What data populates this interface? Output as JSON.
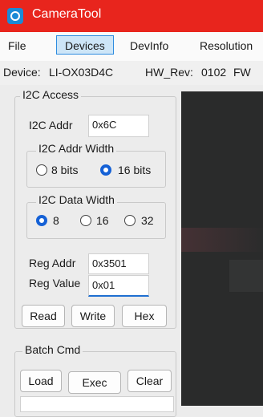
{
  "window": {
    "title": "CameraTool",
    "accent": "#e8251d"
  },
  "menu": {
    "items": [
      "File",
      "Devices",
      "DevInfo",
      "Resolution"
    ],
    "active": "Devices"
  },
  "device_info": {
    "device_label": "Device:",
    "device_value": "LI-OX03D4C",
    "hw_rev_label": "HW_Rev:",
    "hw_rev_value": "0102",
    "next": "FW"
  },
  "i2c_access": {
    "title": "I2C Access",
    "addr_label": "I2C Addr",
    "addr_value": "0x6C",
    "addr_width": {
      "title": "I2C Addr Width",
      "options": [
        "8 bits",
        "16 bits"
      ],
      "selected": "16 bits"
    },
    "data_width": {
      "title": "I2C Data Width",
      "options": [
        "8",
        "16",
        "32"
      ],
      "selected": "8"
    },
    "reg_addr_label": "Reg Addr",
    "reg_addr_value": "0x3501",
    "reg_value_label": "Reg Value",
    "reg_value_value": "0x01",
    "buttons": {
      "read": "Read",
      "write": "Write",
      "hex": "Hex"
    }
  },
  "batch_cmd": {
    "title": "Batch Cmd",
    "buttons": {
      "load": "Load",
      "exec": "Exec",
      "clear": "Clear"
    }
  }
}
